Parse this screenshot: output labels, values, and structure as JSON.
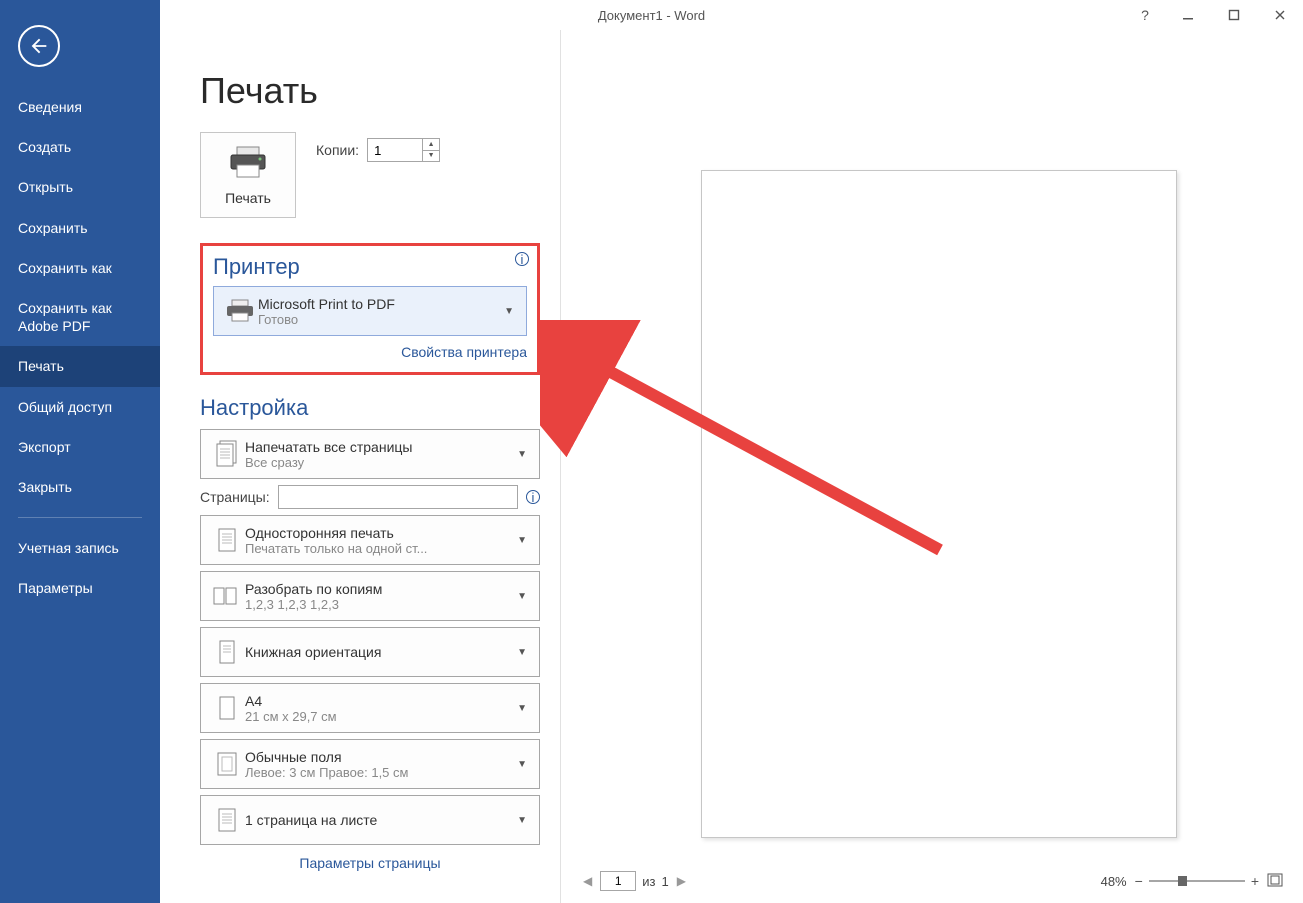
{
  "titlebar": {
    "title": "Документ1 - Word"
  },
  "sidebar": {
    "items": [
      {
        "label": "Сведения"
      },
      {
        "label": "Создать"
      },
      {
        "label": "Открыть"
      },
      {
        "label": "Сохранить"
      },
      {
        "label": "Сохранить как"
      },
      {
        "label": "Сохранить как Adobe PDF"
      },
      {
        "label": "Печать",
        "active": true
      },
      {
        "label": "Общий доступ"
      },
      {
        "label": "Экспорт"
      },
      {
        "label": "Закрыть"
      }
    ],
    "footer": [
      {
        "label": "Учетная запись"
      },
      {
        "label": "Параметры"
      }
    ]
  },
  "print": {
    "heading": "Печать",
    "button_label": "Печать",
    "copies_label": "Копии:",
    "copies_value": "1"
  },
  "printer": {
    "section_title": "Принтер",
    "name": "Microsoft Print to PDF",
    "status": "Готово",
    "properties_link": "Свойства принтера"
  },
  "settings": {
    "section_title": "Настройка",
    "print_range": {
      "title": "Напечатать все страницы",
      "sub": "Все сразу"
    },
    "pages_label": "Страницы:",
    "pages_value": "",
    "duplex": {
      "title": "Односторонняя печать",
      "sub": "Печатать только на одной ст..."
    },
    "collate": {
      "title": "Разобрать по копиям",
      "sub": "1,2,3    1,2,3    1,2,3"
    },
    "orientation": {
      "title": "Книжная ориентация",
      "sub": ""
    },
    "paper": {
      "title": "A4",
      "sub": "21 см x 29,7 см"
    },
    "margins": {
      "title": "Обычные поля",
      "sub": "Левое:  3 см    Правое:  1,5 см"
    },
    "per_sheet": {
      "title": "1 страница на листе",
      "sub": ""
    },
    "page_setup_link": "Параметры страницы"
  },
  "preview": {
    "page_current": "1",
    "page_total_prefix": "из",
    "page_total": "1",
    "zoom": "48%"
  }
}
